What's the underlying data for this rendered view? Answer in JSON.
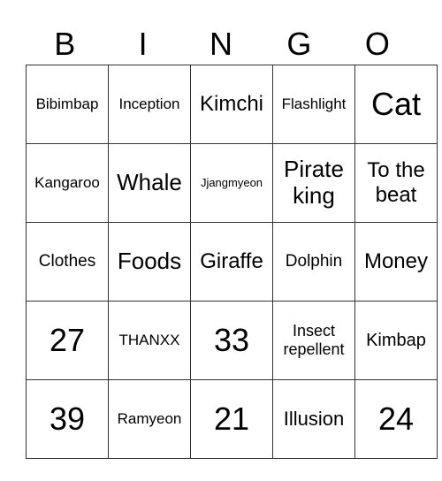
{
  "header": [
    "B",
    "I",
    "N",
    "G",
    "O"
  ],
  "rows": [
    [
      {
        "t": "Bibimbap",
        "s": 17
      },
      {
        "t": "Inception",
        "s": 17
      },
      {
        "t": "Kimchi",
        "s": 24
      },
      {
        "t": "Flashlight",
        "s": 17
      },
      {
        "t": "Cat",
        "s": 36
      }
    ],
    [
      {
        "t": "Kangaroo",
        "s": 17
      },
      {
        "t": "Whale",
        "s": 26
      },
      {
        "t": "Jjangmyeon",
        "s": 13
      },
      {
        "t": "Pirate king",
        "s": 26
      },
      {
        "t": "To the beat",
        "s": 24
      }
    ],
    [
      {
        "t": "Clothes",
        "s": 19
      },
      {
        "t": "Foods",
        "s": 26
      },
      {
        "t": "Giraffe",
        "s": 24
      },
      {
        "t": "Dolphin",
        "s": 19
      },
      {
        "t": "Money",
        "s": 24
      }
    ],
    [
      {
        "t": "27",
        "s": 36
      },
      {
        "t": "THANXX",
        "s": 17
      },
      {
        "t": "33",
        "s": 36
      },
      {
        "t": "Insect repellent",
        "s": 18
      },
      {
        "t": "Kimbap",
        "s": 20
      }
    ],
    [
      {
        "t": "39",
        "s": 36
      },
      {
        "t": "Ramyeon",
        "s": 17
      },
      {
        "t": "21",
        "s": 36
      },
      {
        "t": "Illusion",
        "s": 22
      },
      {
        "t": "24",
        "s": 36
      }
    ]
  ]
}
